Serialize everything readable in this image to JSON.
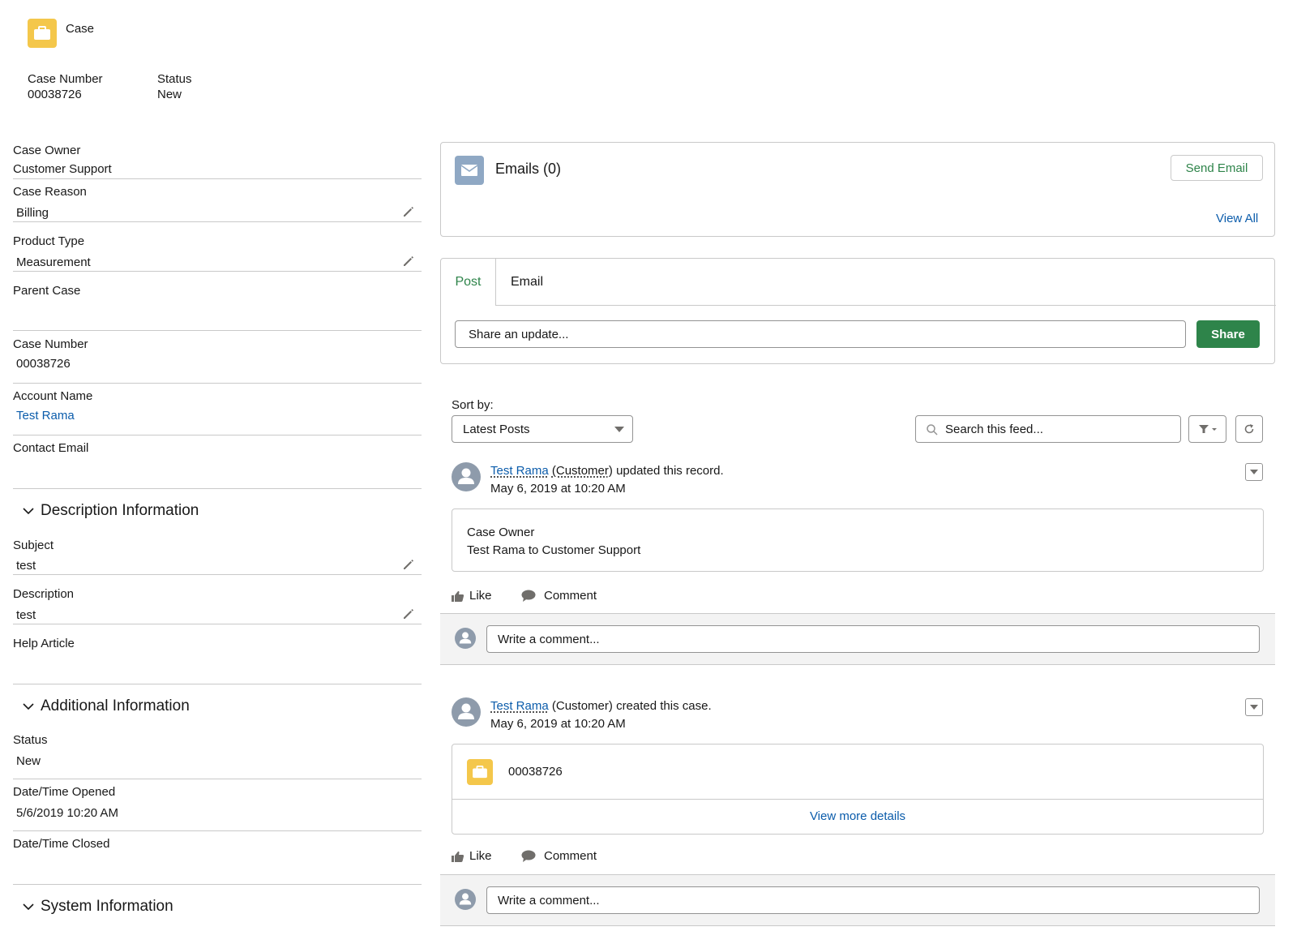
{
  "header": {
    "object_label": "Case",
    "fields": [
      {
        "label": "Case Number",
        "value": "00038726"
      },
      {
        "label": "Status",
        "value": "New"
      }
    ]
  },
  "details": {
    "case_owner": {
      "label": "Case Owner",
      "value": "Customer Support"
    },
    "case_reason": {
      "label": "Case Reason",
      "value": "Billing"
    },
    "product_type": {
      "label": "Product Type",
      "value": "Measurement"
    },
    "parent_case": {
      "label": "Parent Case",
      "value": ""
    },
    "case_number": {
      "label": "Case Number",
      "value": "00038726"
    },
    "account_name": {
      "label": "Account Name",
      "value": "Test Rama"
    },
    "contact_email": {
      "label": "Contact Email",
      "value": ""
    }
  },
  "description_section": {
    "title": "Description Information",
    "subject": {
      "label": "Subject",
      "value": "test"
    },
    "description": {
      "label": "Description",
      "value": "test"
    },
    "help_article": {
      "label": "Help Article",
      "value": ""
    }
  },
  "additional_section": {
    "title": "Additional Information",
    "status": {
      "label": "Status",
      "value": "New"
    },
    "opened": {
      "label": "Date/Time Opened",
      "value": "5/6/2019 10:20 AM"
    },
    "closed": {
      "label": "Date/Time Closed",
      "value": ""
    }
  },
  "system_section": {
    "title": "System Information"
  },
  "emails": {
    "title": "Emails (0)",
    "send_label": "Send Email",
    "view_all": "View All"
  },
  "publisher": {
    "tabs": [
      "Post",
      "Email"
    ],
    "placeholder": "Share an update...",
    "share_label": "Share"
  },
  "feed": {
    "sort_label": "Sort by:",
    "sort_value": "Latest Posts",
    "search_placeholder": "Search this feed...",
    "items": [
      {
        "actor": "Test Rama",
        "role": "(Customer)",
        "action": "updated this record.",
        "timestamp": "May 6, 2019 at 10:20 AM",
        "body_line1": "Case Owner",
        "body_line2": "Test Rama to Customer Support"
      },
      {
        "actor": "Test Rama",
        "role": "(Customer)",
        "action": "created this case.",
        "timestamp": "May 6, 2019 at 10:20 AM",
        "record": "00038726",
        "more": "View more details"
      }
    ],
    "like_label": "Like",
    "comment_label": "Comment",
    "comment_placeholder": "Write a comment..."
  },
  "colors": {
    "brand_green": "#2e844a",
    "link_blue": "#0b5cab",
    "case_yellow": "#f4c74b",
    "email_blue": "#8fa8c4"
  }
}
